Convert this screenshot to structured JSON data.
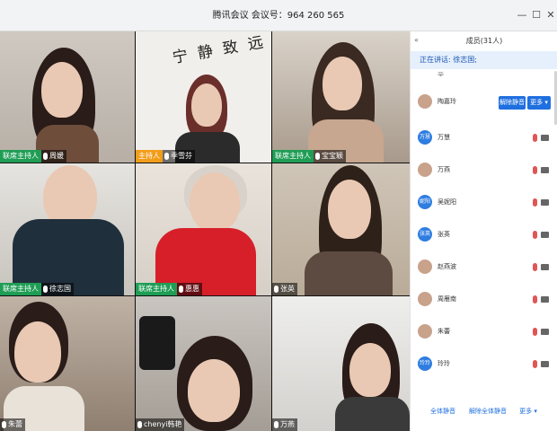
{
  "window": {
    "title": "腾讯会议 会议号：964 260 565",
    "minimize": "—",
    "maximize": "☐",
    "close": "✕"
  },
  "colors": {
    "accent": "#1f6fe0",
    "cohost": "#1f9d55",
    "host": "#f29d1a",
    "muted": "#e25555"
  },
  "tiles": [
    {
      "role": "联席主持人",
      "name": "周媛",
      "role_type": "cohost"
    },
    {
      "role": "主持人",
      "name": "季雪芬",
      "role_type": "host"
    },
    {
      "role": "联席主持人",
      "name": "宝宝颖",
      "role_type": "cohost"
    },
    {
      "role": "联席主持人",
      "name": "徐志国",
      "role_type": "cohost"
    },
    {
      "role": "联席主持人",
      "name": "惠惠",
      "role_type": "cohost"
    },
    {
      "role": "",
      "name": "张英",
      "role_type": ""
    },
    {
      "role": "",
      "name": "朱蕾",
      "role_type": ""
    },
    {
      "role": "",
      "name": "chenyi韩艳",
      "role_type": ""
    },
    {
      "role": "",
      "name": "万燕",
      "role_type": ""
    }
  ],
  "tile_wall_text": "宁 静 致 远",
  "panel": {
    "title": "成员(31人)",
    "speaking": "正在讲话: 徐志国;",
    "cutoff_name": "荣",
    "host_member": {
      "name": "陶嘉玲",
      "mute_label": "解除静音",
      "more_label": "更多 ▾"
    },
    "members": [
      {
        "name": "万慧",
        "avatar_text": "万慧",
        "avatar": "blue"
      },
      {
        "name": "万燕",
        "avatar_text": "",
        "avatar": "photo"
      },
      {
        "name": "吴妮阳",
        "avatar_text": "妮阳",
        "avatar": "blue"
      },
      {
        "name": "张英",
        "avatar_text": "张英",
        "avatar": "blue"
      },
      {
        "name": "赵燕波",
        "avatar_text": "",
        "avatar": "photo"
      },
      {
        "name": "周雁南",
        "avatar_text": "",
        "avatar": "photo"
      },
      {
        "name": "朱蕾",
        "avatar_text": "",
        "avatar": "photo"
      },
      {
        "name": "玲玲",
        "avatar_text": "玲玲",
        "avatar": "blue"
      }
    ],
    "footer": {
      "mute_all": "全体静音",
      "unmute_all": "解除全体静音",
      "more": "更多 ▾"
    }
  },
  "icons": {
    "mic": "mic-icon",
    "camera": "camera-icon",
    "collapse": "collapse-icon"
  }
}
